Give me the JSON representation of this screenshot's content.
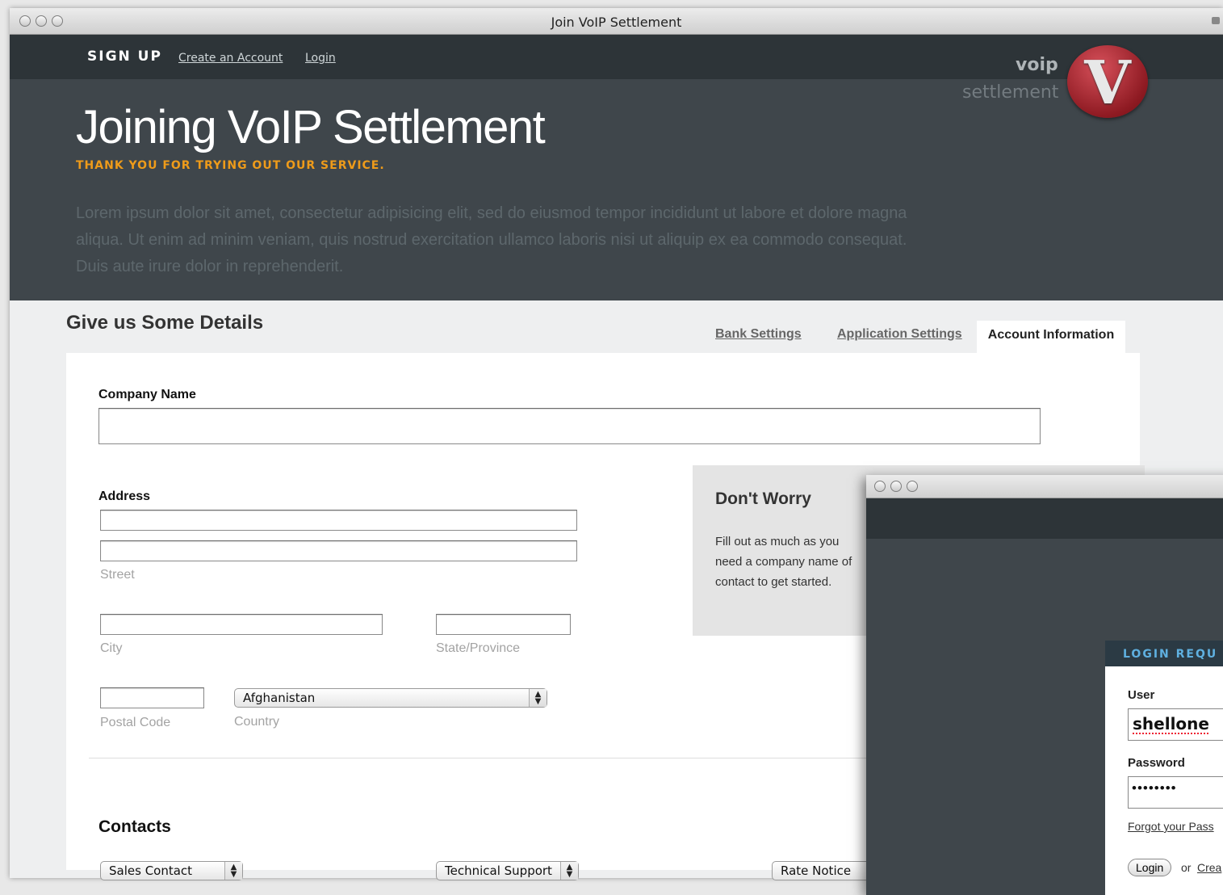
{
  "window": {
    "title": "Join VoIP Settlement"
  },
  "nav": {
    "signup": "SIGN UP",
    "create_account": "Create an Account",
    "login": "Login"
  },
  "logo": {
    "word1": "voip",
    "word2": "settlement",
    "letter": "V"
  },
  "hero": {
    "title": "Joining VoIP Settlement",
    "tagline": "THANK YOU FOR TRYING OUT OUR SERVICE.",
    "body": "Lorem ipsum dolor sit amet, consectetur adipisicing elit, sed do eiusmod tempor incididunt ut labore et dolore magna aliqua. Ut enim ad minim veniam, quis nostrud exercitation ullamco laboris nisi ut aliquip ex ea commodo consequat. Duis aute irure dolor in reprehenderit."
  },
  "form": {
    "section_title": "Give us Some Details",
    "tabs": [
      "Bank Settings",
      "Application Settings",
      "Account Information"
    ],
    "active_tab": "Account Information",
    "company_label": "Company Name",
    "company_value": "",
    "address_label": "Address",
    "street_hint": "Street",
    "city_hint": "City",
    "state_hint": "State/Province",
    "postal_hint": "Postal Code",
    "country_hint": "Country",
    "country_value": "Afghanistan",
    "contacts_label": "Contacts",
    "contact_selects": [
      "Sales Contact",
      "Technical Support",
      "Rate Notice"
    ]
  },
  "sidebar_note": {
    "title": "Don't Worry",
    "text": "Fill out as much as you need a company name of contact to get started."
  },
  "login_window": {
    "header": "LOGIN REQU",
    "user_label": "User",
    "user_value": "shellone",
    "password_label": "Password",
    "password_value": "••••••••",
    "forgot_link": "Forgot your Pass",
    "login_button": "Login",
    "or_text": "or",
    "create_link": "Crea"
  }
}
